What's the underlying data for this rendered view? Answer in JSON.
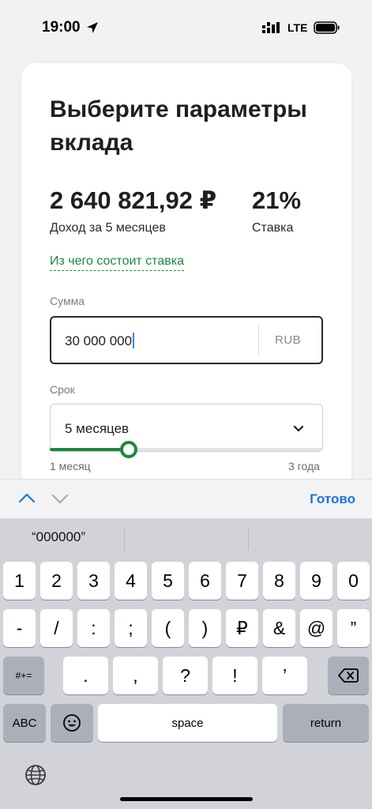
{
  "status_bar": {
    "time": "19:00",
    "network": "LTE"
  },
  "deposit": {
    "title": "Выберите параметры вклада",
    "income_value": "2 640 821,92 ₽",
    "income_label": "Доход за 5 месяцев",
    "rate_value": "21%",
    "rate_label": "Ставка",
    "rate_link": "Из чего состоит ставка",
    "sum_label": "Сумма",
    "sum_value": "30 000 000",
    "sum_currency": "RUB",
    "term_label": "Срок",
    "term_value": "5 месяцев",
    "term_slider_fraction": 0.29,
    "term_min": "1 месяц",
    "term_max": "3 года"
  },
  "accessory": {
    "done_label": "Готово"
  },
  "keyboard": {
    "suggestion": "“000000”",
    "row1": [
      "1",
      "2",
      "3",
      "4",
      "5",
      "6",
      "7",
      "8",
      "9",
      "0"
    ],
    "row2": [
      "-",
      "/",
      ":",
      ";",
      "(",
      ")",
      "₽",
      "&",
      "@",
      "”"
    ],
    "row3_left": "#+=",
    "row3": [
      ".",
      ",",
      "?",
      "!",
      "’"
    ],
    "abc": "ABC",
    "space": "space",
    "return": "return"
  },
  "colors": {
    "accent_green": "#1a8a3d",
    "done_blue": "#1a73d9"
  }
}
